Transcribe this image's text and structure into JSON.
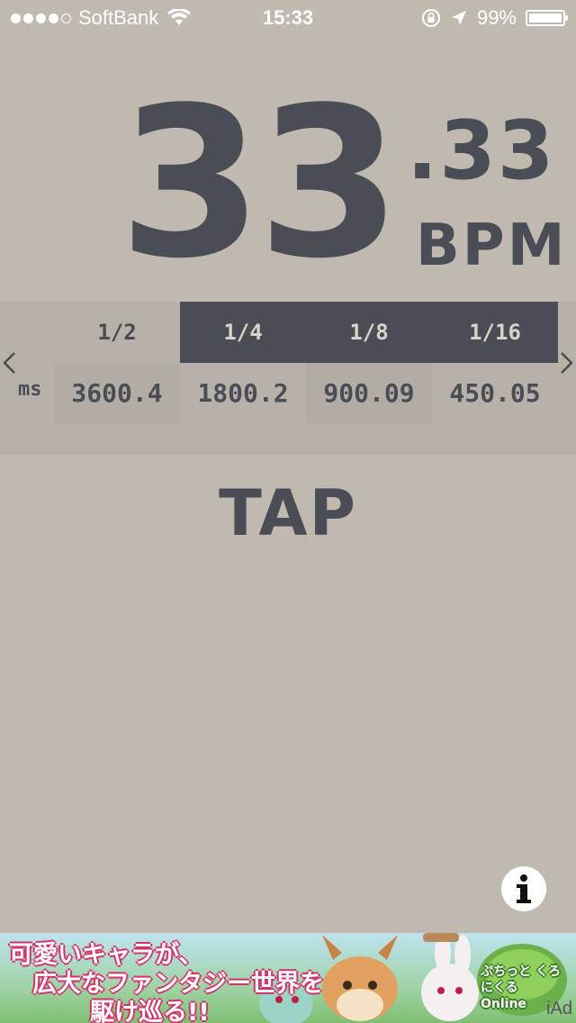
{
  "status_bar": {
    "carrier": "SoftBank",
    "time": "15:33",
    "battery_percent": "99%",
    "battery_level": 0.99,
    "signal_dots_filled": 4,
    "signal_dots_total": 5
  },
  "display": {
    "bpm_integer": "33",
    "bpm_fraction": ".33",
    "bpm_unit": "BPM"
  },
  "note_table": {
    "ms_label": "ms",
    "columns": [
      {
        "note": "1/2",
        "ms": "3600.4",
        "active": false
      },
      {
        "note": "1/4",
        "ms": "1800.2",
        "active": true
      },
      {
        "note": "1/8",
        "ms": "900.09",
        "active": true
      },
      {
        "note": "1/16",
        "ms": "450.05",
        "active": true
      }
    ]
  },
  "tap_label": "TAP",
  "info_icon": "info-icon",
  "ad": {
    "line1": "可愛いキャラが、",
    "line2": "広大なファンタジー世界を",
    "line3": "駆け巡る!!",
    "logo_text": "ぷちっと くろにくる Online",
    "provider": "iAd"
  },
  "colors": {
    "background": "#c0b9b0",
    "text": "#4a4d55",
    "active_header": "#4a4d55"
  }
}
